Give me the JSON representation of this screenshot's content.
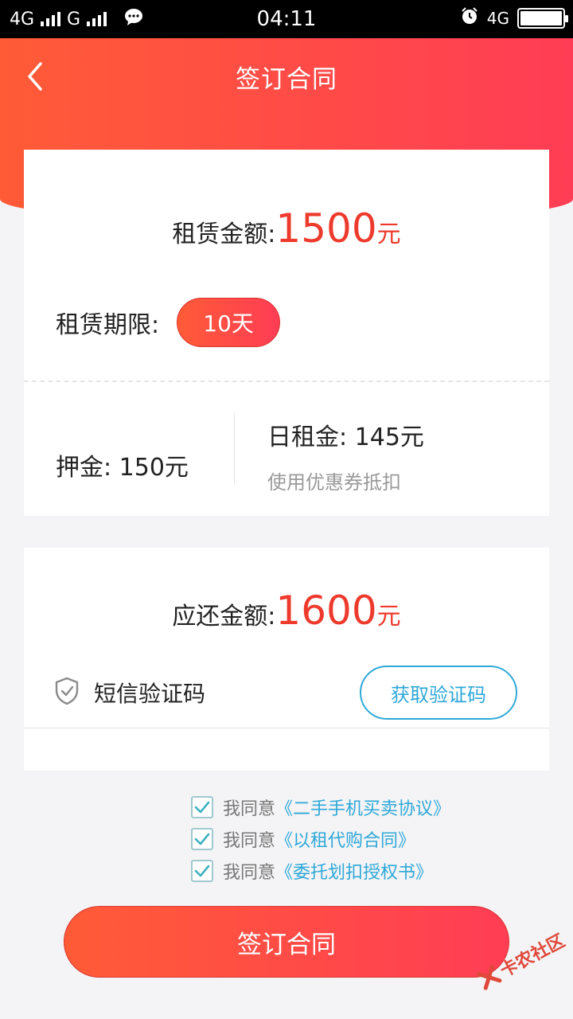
{
  "status_bar": {
    "network1": "4G",
    "network2": "G",
    "time": "04:11",
    "network3": "4G"
  },
  "header": {
    "title": "签订合同"
  },
  "rental": {
    "amount_label": "租赁金额:",
    "amount_value": "1500",
    "amount_unit": "元",
    "term_label": "租赁期限:",
    "term_value": "10天",
    "deposit": "押金: 150元",
    "daily_rent": "日租金: 145元",
    "coupon_text": "使用优惠券抵扣"
  },
  "repayment": {
    "amount_label": "应还金额:",
    "amount_value": "1600",
    "amount_unit": "元",
    "sms_label": "短信验证码",
    "get_code_label": "获取验证码",
    "code_input_value": ""
  },
  "agreements": [
    {
      "prefix": "我同意",
      "link": "《二手手机买卖协议》",
      "checked": true
    },
    {
      "prefix": "我同意",
      "link": "《以租代购合同》",
      "checked": true
    },
    {
      "prefix": "我同意",
      "link": "《委托划扣授权书》",
      "checked": true
    }
  ],
  "submit_label": "签订合同",
  "watermark": "卡农社区",
  "colors": {
    "brand_start": "#ff5b37",
    "brand_end": "#ff3d55",
    "amount_red": "#ee3a2c",
    "link_blue": "#2ea8d8"
  }
}
